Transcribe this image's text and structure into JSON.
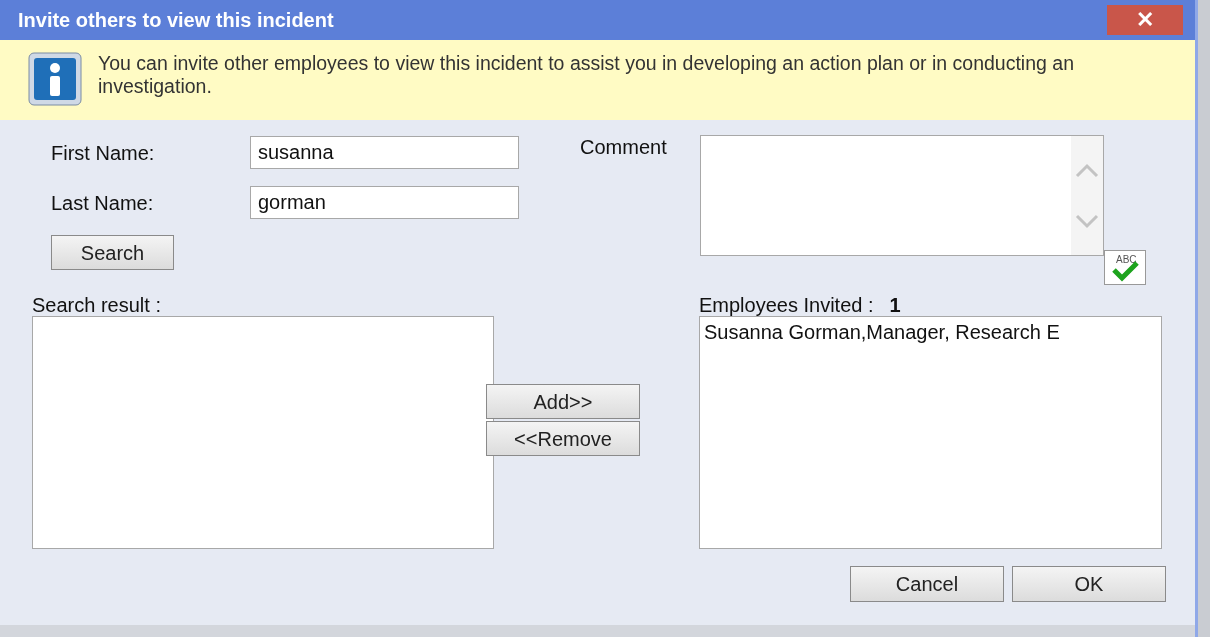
{
  "window": {
    "title": "Invite others to view this incident",
    "close_label": "✕"
  },
  "info": {
    "text": "You can invite other employees to view this incident to assist you in developing an action plan or in conducting an investigation."
  },
  "form": {
    "first_name": {
      "label": "First Name:",
      "value": "susanna"
    },
    "last_name": {
      "label": "Last Name:",
      "value": "gorman"
    },
    "search_button": "Search",
    "comment": {
      "label": "Comment",
      "spellcheck_label": "ABC"
    }
  },
  "search_result": {
    "label": "Search result :"
  },
  "add_button": "Add>>",
  "remove_button": "<<Remove",
  "invited": {
    "label": "Employees Invited :",
    "count": "1",
    "items": [
      {
        "text": "Susanna Gorman,Manager, Research E"
      }
    ]
  },
  "buttons": [
    {
      "label": "Cancel"
    },
    {
      "label": "OK"
    }
  ]
}
